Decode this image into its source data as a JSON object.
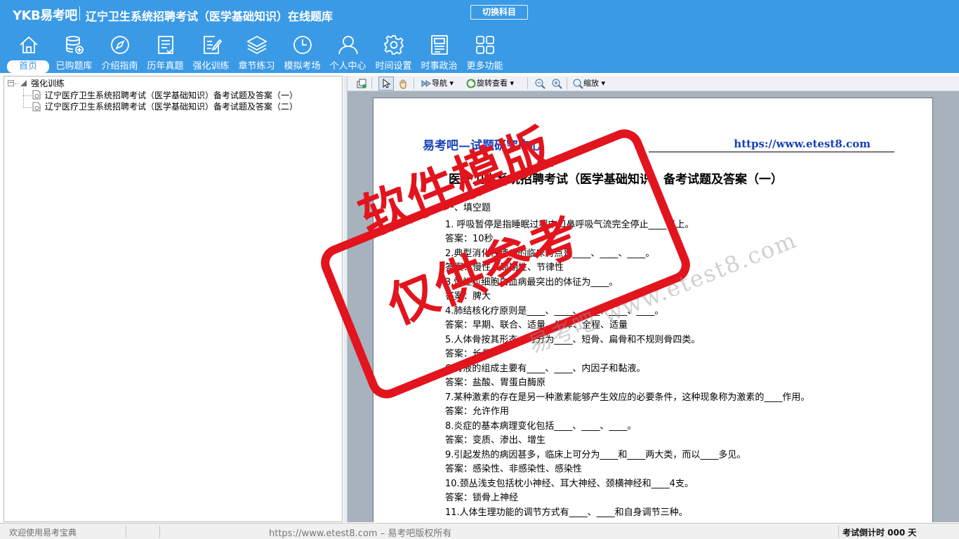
{
  "header": {
    "logo": "YKB易考吧",
    "title": "辽宁卫生系统招聘考试（医学基础知识）在线题库",
    "switch_subject": "切换科目"
  },
  "nav": [
    {
      "label": "首页",
      "icon": "home-icon",
      "active": true
    },
    {
      "label": "已购题库",
      "icon": "database-icon"
    },
    {
      "label": "介绍指南",
      "icon": "compass-icon"
    },
    {
      "label": "历年真题",
      "icon": "list-document-icon"
    },
    {
      "label": "强化训练",
      "icon": "edit-document-icon"
    },
    {
      "label": "章节练习",
      "icon": "layers-icon"
    },
    {
      "label": "模拟考场",
      "icon": "clock-icon"
    },
    {
      "label": "个人中心",
      "icon": "user-icon"
    },
    {
      "label": "时间设置",
      "icon": "gear-icon"
    },
    {
      "label": "时事政治",
      "icon": "newspaper-icon"
    },
    {
      "label": "更多功能",
      "icon": "grid-icon"
    }
  ],
  "tree": {
    "root": "强化训练",
    "items": [
      "辽宁医疗卫生系统招聘考试（医学基础知识）备考试题及答案（一）",
      "辽宁医疗卫生系统招聘考试（医学基础知识）备考试题及答案（二）"
    ]
  },
  "toolbar": {
    "navigate": "导航",
    "rotate": "旋转查看",
    "zoom": "缩放"
  },
  "document": {
    "header_left": "易考吧—试题研究中心",
    "header_right": "https://www.etest8.com",
    "title": "医疗卫生系统招聘考试（医学基础知识）备考试题及答案（一）",
    "section": "一、填空题",
    "lines": [
      "1.  呼吸暂停是指睡眠过程中口鼻呼吸气流完全停止____以上。",
      "答案：10秒",
      "2.典型消化性溃疡的临床特点是____、____、____。",
      "答案：慢性、周期性、节律性",
      "3.慢性粒细胞白血病最突出的体征为____。",
      "答案：脾大",
      "4.肺结核化疗原则是____、____、____、____、____。",
      "答案：早期、联合、适量、规律、全程、适量",
      "5.人体骨按其形态，可分为____、短骨、扁骨和不规则骨四类。",
      "答案：长骨",
      "6.胃液的组成主要有____、____、内因子和黏液。",
      "答案：盐酸、胃蛋白酶原",
      "7.某种激素的存在是另一种激素能够产生效应的必要条件，这种现象称为激素的____作用。",
      "答案：允许作用",
      "8.炎症的基本病理变化包括____、____、____。",
      "答案：变质、渗出、增生",
      "9.引起发热的病因甚多，临床上可分为____和____两大类，而以____多见。",
      "答案：感染性、非感染性、感染性",
      "10.颈丛浅支包括枕小神经、耳大神经、颈横神经和____4支。",
      "答案：锁骨上神经",
      "11.人体生理功能的调节方式有____、____和自身调节三种。"
    ]
  },
  "watermark": {
    "line1": "软件模版",
    "line2": "仅供参考",
    "site": "易考吧 www.etest8.com"
  },
  "status": {
    "left": "欢迎使用易考宝典",
    "center": "https://www.etest8.com – 易考吧版权所有",
    "right": "考试倒计时 000 天"
  }
}
